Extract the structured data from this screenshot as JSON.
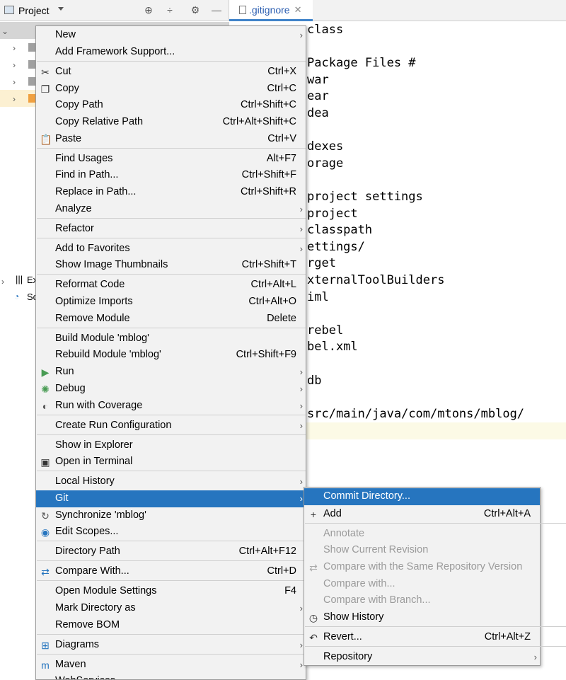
{
  "project_panel": {
    "title": "Project",
    "bottom_items": [
      "Ex",
      "Sc"
    ]
  },
  "editor": {
    "tab_label": ".gitignore",
    "lines": [
      "class",
      "",
      "Package Files #",
      "war",
      "ear",
      "dea",
      "",
      "dexes",
      "orage",
      "",
      "project settings",
      "project",
      "classpath",
      "ettings/",
      "rget",
      "xternalToolBuilders",
      "iml",
      "",
      "rebel",
      "bel.xml",
      "",
      "db",
      "",
      "src/main/java/com/mtons/mblog/"
    ]
  },
  "context_menu": {
    "items": [
      {
        "label": "New",
        "submenu": true
      },
      {
        "label": "Add Framework Support..."
      },
      {
        "label": "Cut",
        "shortcut": "Ctrl+X",
        "icon": "scissors-icon"
      },
      {
        "label": "Copy",
        "shortcut": "Ctrl+C",
        "icon": "copy-icon"
      },
      {
        "label": "Copy Path",
        "shortcut": "Ctrl+Shift+C"
      },
      {
        "label": "Copy Relative Path",
        "shortcut": "Ctrl+Alt+Shift+C"
      },
      {
        "label": "Paste",
        "shortcut": "Ctrl+V",
        "icon": "clipboard-icon"
      },
      {
        "label": "Find Usages",
        "shortcut": "Alt+F7"
      },
      {
        "label": "Find in Path...",
        "shortcut": "Ctrl+Shift+F"
      },
      {
        "label": "Replace in Path...",
        "shortcut": "Ctrl+Shift+R"
      },
      {
        "label": "Analyze",
        "submenu": true
      },
      {
        "label": "Refactor",
        "submenu": true
      },
      {
        "label": "Add to Favorites",
        "submenu": true
      },
      {
        "label": "Show Image Thumbnails",
        "shortcut": "Ctrl+Shift+T"
      },
      {
        "label": "Reformat Code",
        "shortcut": "Ctrl+Alt+L"
      },
      {
        "label": "Optimize Imports",
        "shortcut": "Ctrl+Alt+O"
      },
      {
        "label": "Remove Module",
        "shortcut": "Delete"
      },
      {
        "label": "Build Module 'mblog'"
      },
      {
        "label": "Rebuild Module 'mblog'",
        "shortcut": "Ctrl+Shift+F9"
      },
      {
        "label": "Run",
        "submenu": true,
        "icon": "run-icon"
      },
      {
        "label": "Debug",
        "submenu": true,
        "icon": "debug-icon"
      },
      {
        "label": "Run with Coverage",
        "submenu": true,
        "icon": "coverage-icon"
      },
      {
        "label": "Create Run Configuration",
        "submenu": true
      },
      {
        "label": "Show in Explorer"
      },
      {
        "label": "Open in Terminal",
        "icon": "terminal-icon"
      },
      {
        "label": "Local History",
        "submenu": true
      },
      {
        "label": "Git",
        "submenu": true
      },
      {
        "label": "Synchronize 'mblog'",
        "icon": "sync-icon"
      },
      {
        "label": "Edit Scopes...",
        "icon": "scope-icon"
      },
      {
        "label": "Directory Path",
        "shortcut": "Ctrl+Alt+F12"
      },
      {
        "label": "Compare With...",
        "shortcut": "Ctrl+D",
        "icon": "compare-icon"
      },
      {
        "label": "Open Module Settings",
        "shortcut": "F4"
      },
      {
        "label": "Mark Directory as",
        "submenu": true
      },
      {
        "label": "Remove BOM"
      },
      {
        "label": "Diagrams",
        "submenu": true,
        "icon": "diagram-icon"
      },
      {
        "label": "Maven",
        "submenu": true,
        "icon": "maven-icon"
      },
      {
        "label": "WebServices",
        "submenu": true
      }
    ]
  },
  "git_submenu": {
    "items": [
      {
        "label": "Commit Directory..."
      },
      {
        "label": "Add",
        "shortcut": "Ctrl+Alt+A",
        "icon": "plus-icon"
      },
      {
        "label": "Annotate",
        "disabled": true
      },
      {
        "label": "Show Current Revision",
        "disabled": true
      },
      {
        "label": "Compare with the Same Repository Version",
        "disabled": true,
        "icon": "compare-icon"
      },
      {
        "label": "Compare with...",
        "disabled": true
      },
      {
        "label": "Compare with Branch...",
        "disabled": true
      },
      {
        "label": "Show History",
        "icon": "clock-icon"
      },
      {
        "label": "Revert...",
        "shortcut": "Ctrl+Alt+Z",
        "icon": "revert-icon"
      },
      {
        "label": "Repository",
        "submenu": true
      }
    ]
  }
}
